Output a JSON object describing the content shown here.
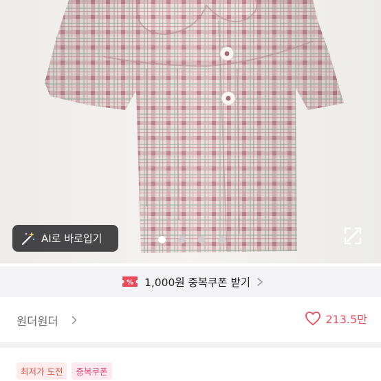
{
  "gallery": {
    "ai_button_label": "AI로 바로입기",
    "ai_icon": "magic-wand-icon",
    "expand_icon": "fullscreen-expand-icon",
    "total_images": 4,
    "current_image": 1
  },
  "coupon_bar": {
    "icon": "coupon-ticket-icon",
    "text": "1,000원 중복쿠폰 받기",
    "accent_color": "#e94b5a"
  },
  "shop": {
    "name": "원더원더",
    "like_icon": "heart-outline-icon",
    "like_count": "213.5만",
    "like_color": "#e8505b"
  },
  "badges": [
    {
      "label": "최저가 도전",
      "color": "#e0564a"
    },
    {
      "label": "중복쿠폰",
      "color": "#e4507a"
    }
  ]
}
